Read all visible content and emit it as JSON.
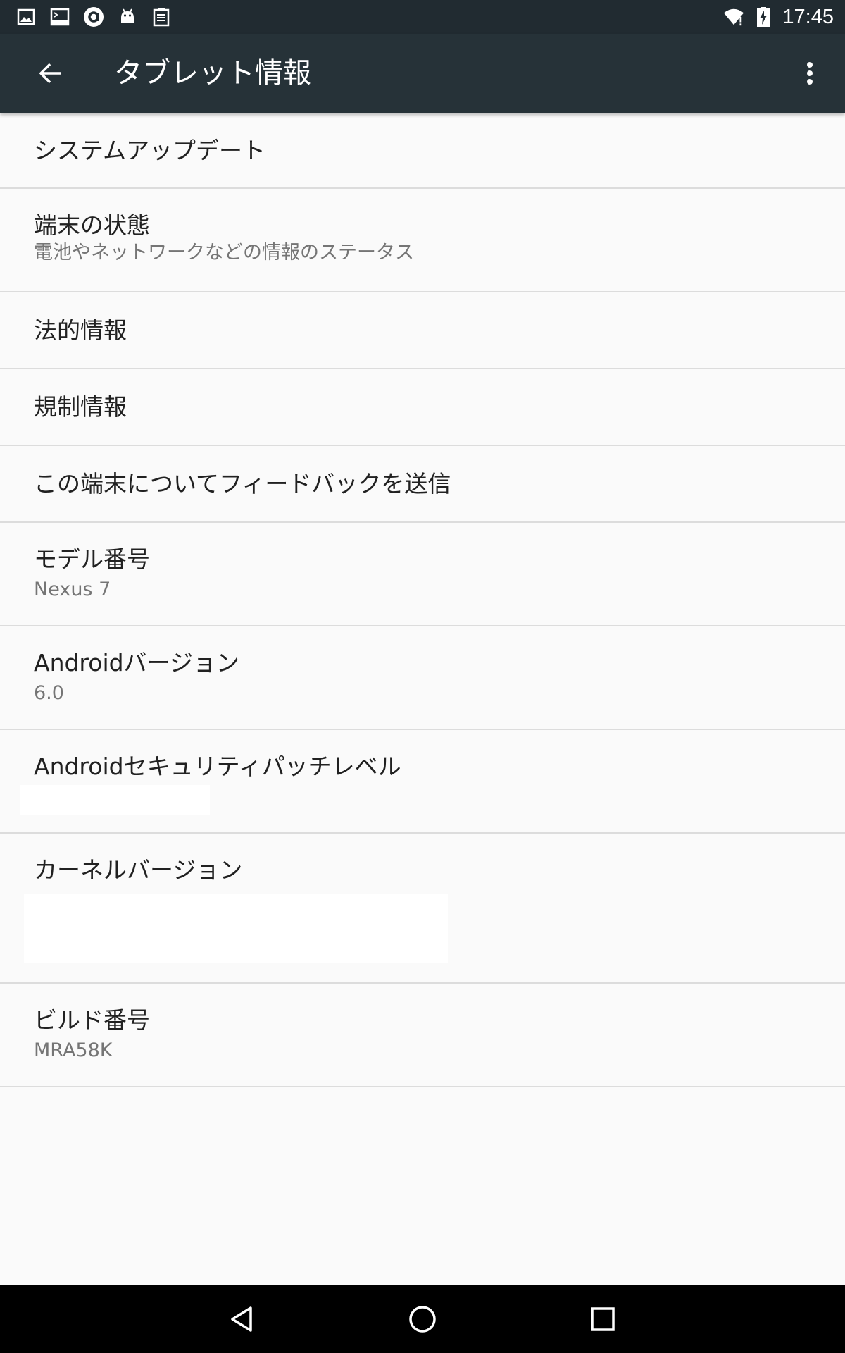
{
  "status_bar": {
    "time": "17:45",
    "left_icons": [
      "image-icon",
      "terminal-icon",
      "circle-a-icon",
      "android-icon",
      "clipboard-icon"
    ],
    "right_icons": [
      "wifi-icon",
      "battery-charging-icon"
    ]
  },
  "toolbar": {
    "title": "タブレット情報",
    "back_icon": "arrow-back-icon",
    "overflow_icon": "more-vert-icon"
  },
  "preferences": [
    {
      "title": "システムアップデート"
    },
    {
      "title": "端末の状態",
      "summary": "電池やネットワークなどの情報のステータス"
    },
    {
      "title": "法的情報"
    },
    {
      "title": "規制情報"
    },
    {
      "title": "この端末についてフィードバックを送信"
    },
    {
      "title": "モデル番号",
      "summary": "Nexus 7"
    },
    {
      "title": "Androidバージョン",
      "summary": "6.0"
    },
    {
      "title": "Androidセキュリティパッチレベル"
    },
    {
      "title": "カーネルバージョン"
    },
    {
      "title": "ビルド番号",
      "summary": "MRA58K"
    }
  ],
  "nav_bar": {
    "icons": [
      "back-triangle-icon",
      "home-circle-icon",
      "recents-square-icon"
    ]
  },
  "colors": {
    "status_bar": "#212b31",
    "toolbar": "#263238",
    "background": "#fafafa",
    "divider": "#dcdcdc",
    "title_text": "#212121",
    "summary_text": "#757575"
  }
}
